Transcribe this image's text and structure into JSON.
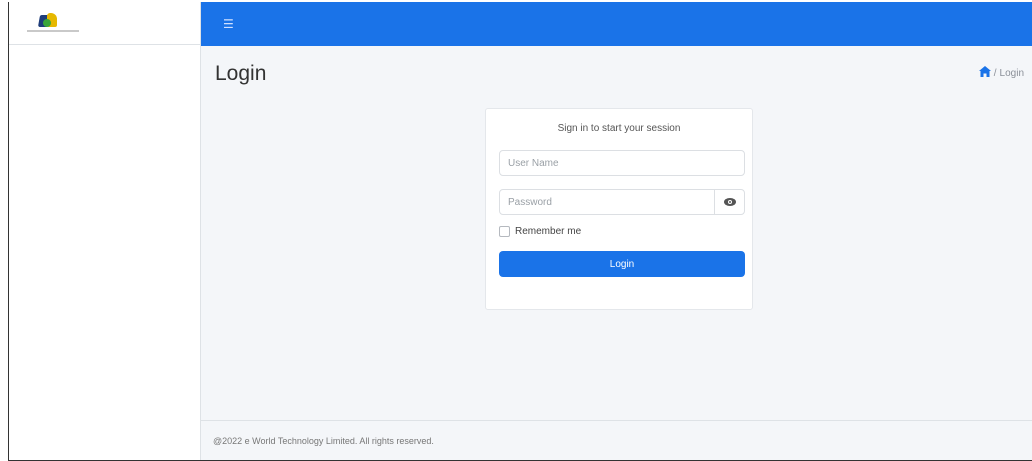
{
  "header": {
    "menu_icon": "hamburger-icon",
    "accent_color": "#1a73e8"
  },
  "page": {
    "title": "Login"
  },
  "breadcrumb": {
    "home_icon": "home-icon",
    "separator": "/",
    "current": "Login"
  },
  "login": {
    "message": "Sign in to start your session",
    "username_placeholder": "User Name",
    "password_placeholder": "Password",
    "show_password_icon": "eye-icon",
    "remember_label": "Remember me",
    "remember_checked": false,
    "button_label": "Login"
  },
  "footer": {
    "text": "@2022 e World Technology Limited. All rights reserved."
  }
}
